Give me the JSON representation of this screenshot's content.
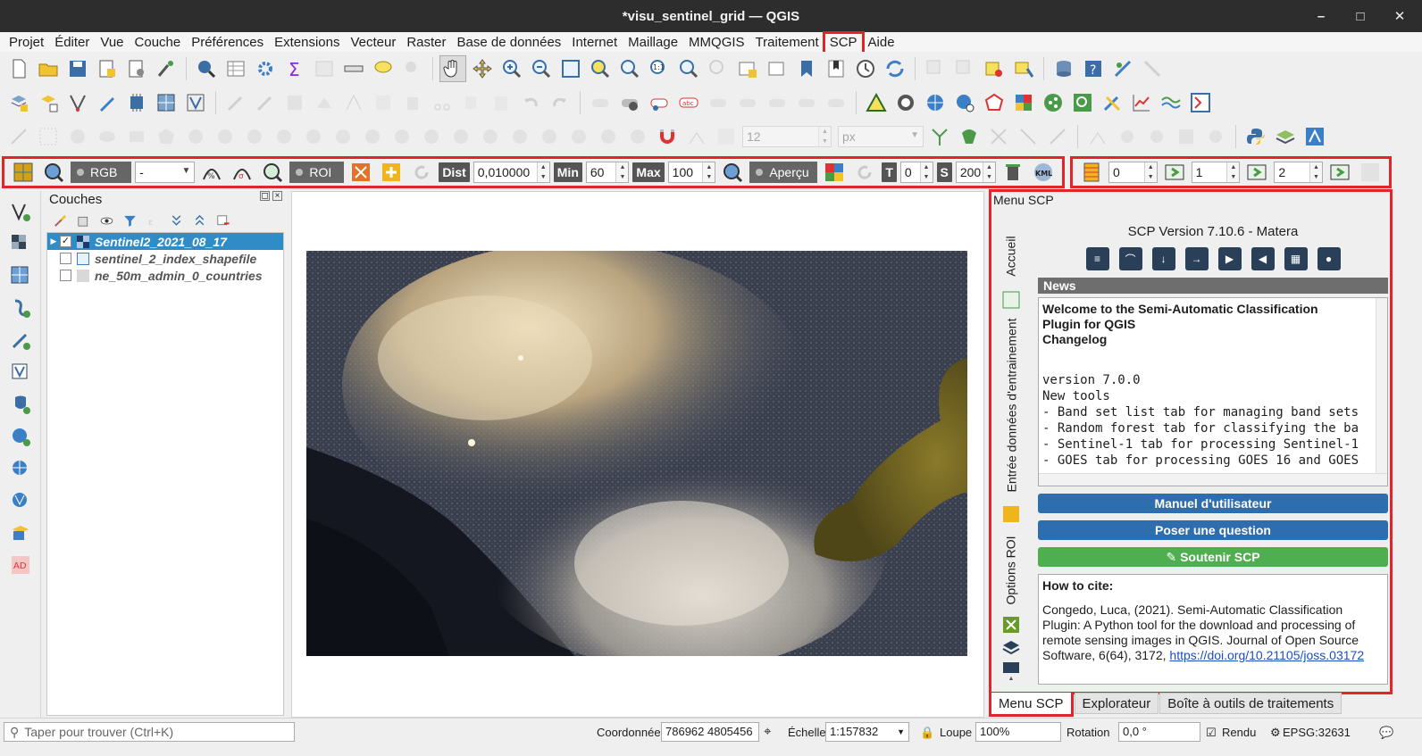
{
  "window": {
    "title": "*visu_sentinel_grid — QGIS"
  },
  "menu": [
    "Projet",
    "Éditer",
    "Vue",
    "Couche",
    "Préférences",
    "Extensions",
    "Vecteur",
    "Raster",
    "Base de données",
    "Internet",
    "Maillage",
    "MMQGIS",
    "Traitement",
    "SCP",
    "Aide"
  ],
  "menu_highlight": "SCP",
  "toolbar3": {
    "font_size": "12",
    "unit": "px"
  },
  "scp_toolbar": {
    "rgb_label": "RGB =",
    "rgb_value": "-",
    "roi_label": "ROI",
    "dist_label": "Dist",
    "dist_value": "0,010000",
    "min_label": "Min",
    "min_value": "60",
    "max_label": "Max",
    "max_value": "100",
    "preview_label": "Aperçu",
    "t_label": "T",
    "t_value": "0",
    "s_label": "S",
    "s_value": "200",
    "kml_label": "KML"
  },
  "band_toolbar": {
    "b1": "0",
    "b2": "1",
    "b3": "2"
  },
  "layers_panel": {
    "title": "Couches",
    "layers": [
      {
        "name": "Sentinel2_2021_08_17",
        "checked": true,
        "selected": true
      },
      {
        "name": "sentinel_2_index_shapefile",
        "checked": false,
        "selected": false
      },
      {
        "name": "ne_50m_admin_0_countries",
        "checked": false,
        "selected": false
      }
    ]
  },
  "scp_dock": {
    "title": "Menu SCP",
    "vtabs": [
      "Accueil",
      "Entrée données d'entrainement",
      "Options ROI"
    ],
    "version": "SCP Version 7.10.6 - Matera",
    "news_header": "News",
    "news_title_lines": [
      "Welcome to the Semi-Automatic Classification",
      "Plugin for QGIS",
      "Changelog"
    ],
    "news_lines": [
      "version 7.0.0",
      "New tools",
      "- Band set list tab for managing band sets",
      "- Random forest tab for classifying the ba",
      "- Sentinel-1 tab for processing Sentinel-1",
      "- GOES tab for processing GOES 16 and GOES"
    ],
    "manual_button": "Manuel d'utilisateur",
    "question_button": "Poser une question",
    "support_button": "Soutenir SCP",
    "cite_title": "How to cite",
    "cite_text": "Congedo, Luca, (2021). Semi-Automatic Classification Plugin: A Python tool for the download and processing of remote sensing images in QGIS. Journal of Open Source Software, 6(64), 3172, ",
    "cite_link": "https://doi.org/10.21105/joss.03172"
  },
  "dock_tabs": [
    "Menu SCP",
    "Explorateur",
    "Boîte à outils de traitements"
  ],
  "statusbar": {
    "locator_placeholder": "Taper pour trouver (Ctrl+K)",
    "coord_label": "Coordonnée",
    "coord_value": "786962 4805456",
    "scale_label": "Échelle",
    "scale_value": "1:157832",
    "magnifier_label": "Loupe",
    "magnifier_value": "100%",
    "rotation_label": "Rotation",
    "rotation_value": "0,0 °",
    "render_label": "Rendu",
    "crs": "EPSG:32631"
  },
  "colors": {
    "highlight": "#e2242b",
    "selection": "#308cc6",
    "button_blue": "#2f6eae",
    "button_green": "#4fae4f"
  }
}
